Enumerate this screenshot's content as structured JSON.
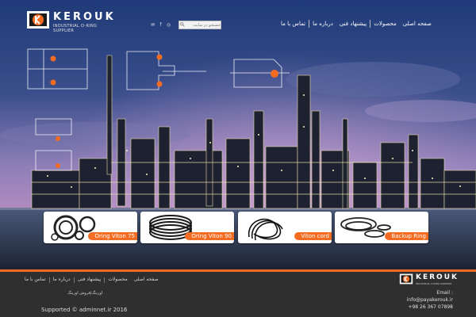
{
  "header": {
    "logo": {
      "brand": "KEROUK",
      "tagline": "INDUSTRIAL O-RING SUPPLIER"
    },
    "social_icons": [
      "email-icon",
      "facebook-icon",
      "instagram-icon"
    ],
    "search": {
      "placeholder": "جستجو در سایت"
    },
    "nav": {
      "items": [
        "صفحه اصلی",
        "محصولات",
        "پیشنهاد فنی",
        "درباره ما",
        "تماس با ما"
      ]
    }
  },
  "products": [
    {
      "label": "Oring Viton 75"
    },
    {
      "label": "Oring Viton 90"
    },
    {
      "label": "Viton cord"
    },
    {
      "label": "Backup Ring"
    }
  ],
  "footer": {
    "nav": [
      "صفحه اصلی",
      "محصولات",
      "پیشنهاد فنی",
      "درباره ما",
      "تماس با ما"
    ],
    "tagline": "اورینگ|فروش اورینگ",
    "copyright": "Supported © adminnet.ir 2016",
    "logo": {
      "brand": "KEROUK",
      "tagline": "INDUSTRIAL O-RING SUPPLIER"
    },
    "contact": {
      "email_label": "Email :",
      "email": "info@payakerouk.ir",
      "phone": "+98 26 367 07898"
    }
  },
  "colors": {
    "accent": "#f36c21",
    "footer_bg": "#2f2f2f",
    "sky_top": "#3a4f86",
    "sky_mid": "#8c7fb3"
  }
}
